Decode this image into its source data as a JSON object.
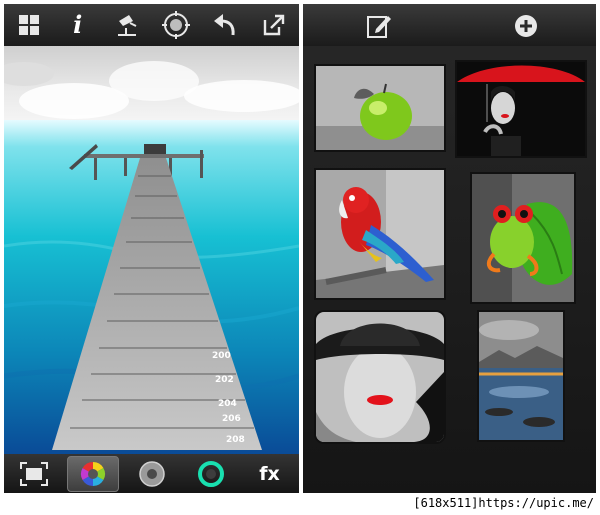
{
  "left_screen": {
    "toolbar": {
      "icons": [
        "grid-icon",
        "info-icon",
        "spotlight-icon",
        "target-icon",
        "undo-icon",
        "share-icon"
      ],
      "info_glyph": "i"
    },
    "bottom_toolbar": {
      "icons": [
        "crop-frame-icon",
        "color-wheel-icon",
        "gray-wheel-icon",
        "teal-wheel-icon"
      ],
      "active": "color-wheel-icon",
      "fx_label": "fx"
    },
    "photo": {
      "plank_numbers": [
        "208",
        "206",
        "204",
        "202",
        "200"
      ]
    }
  },
  "right_screen": {
    "toolbar": {
      "icons": [
        "edit-icon",
        "add-icon"
      ]
    },
    "gallery": {
      "thumbnails": [
        "green-apple",
        "red-umbrella-woman",
        "red-parrot",
        "green-tree-frog",
        "red-lips-hat-woman",
        "lake-landscape"
      ]
    }
  },
  "watermark": "[618x511]https://upic.me/",
  "colors": {
    "toolbar_dark": "#1b1b1b",
    "toolbar_light": "#3a3a3a",
    "water_teal": "#12b8c8",
    "deep_blue": "#0a4f9a",
    "accent_red": "#e3121b",
    "accent_green": "#86c914"
  }
}
